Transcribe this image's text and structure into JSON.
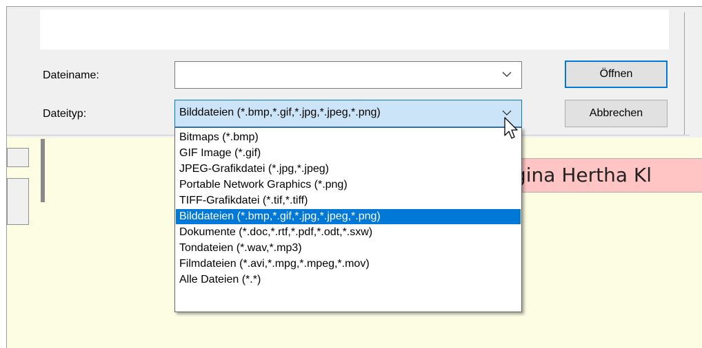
{
  "background": {
    "name_field_text": "gina Hertha Kl"
  },
  "dialog": {
    "filename_label": "Dateiname:",
    "filename_value": "",
    "filetype_label": "Dateityp:",
    "filetype_selected": "Bilddateien (*.bmp,*.gif,*.jpg,*.jpeg,*.png)",
    "open_button": "Öffnen",
    "cancel_button": "Abbrechen"
  },
  "dropdown": {
    "options": [
      "Bitmaps (*.bmp)",
      "GIF Image (*.gif)",
      "JPEG-Grafikdatei (*.jpg,*.jpeg)",
      "Portable Network Graphics (*.png)",
      "TIFF-Grafikdatei (*.tif,*.tiff)",
      "Bilddateien (*.bmp,*.gif,*.jpg,*.jpeg,*.png)",
      "Dokumente (*.doc,*.rtf,*.pdf,*.odt,*.sxw)",
      "Tondateien (*.wav,*.mp3)",
      "Filmdateien (*.avi,*.mpg,*.mpeg,*.mov)",
      "Alle Dateien (*.*)"
    ],
    "selected_index": 5
  },
  "colors": {
    "selection": "#0078d7",
    "app_background": "#fdfde4",
    "name_field_bg": "#ffc4c4"
  },
  "icons": [
    "chevron-down-icon",
    "mouse-cursor-icon"
  ]
}
